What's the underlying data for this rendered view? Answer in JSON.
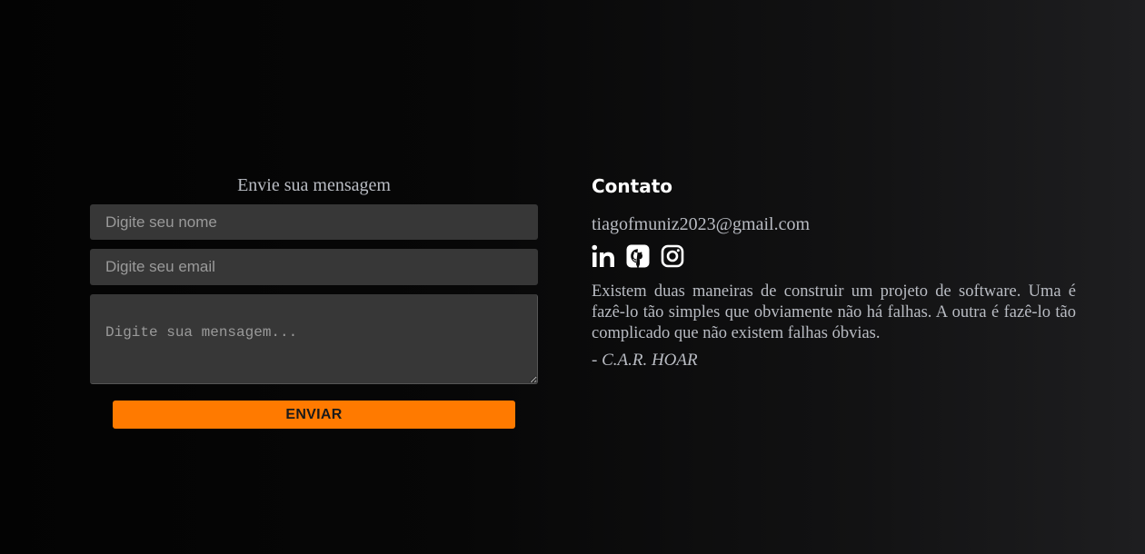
{
  "form": {
    "title": "Envie sua mensagem",
    "name_placeholder": "Digite seu nome",
    "email_placeholder": "Digite seu email",
    "message_placeholder": "Digite sua mensagem...",
    "submit_label": "ENVIAR"
  },
  "contact": {
    "title": "Contato",
    "email": "tiagofmuniz2023@gmail.com",
    "social": [
      {
        "icon": "linkedin-icon"
      },
      {
        "icon": "github-icon"
      },
      {
        "icon": "instagram-icon"
      }
    ],
    "quote": "Existem duas maneiras de construir um projeto de software. Uma é fazê-lo tão simples que obviamente não há falhas. A outra é fazê-lo tão complicado que não existem falhas óbvias.",
    "author": "- C.A.R. HOAR"
  },
  "colors": {
    "accent": "#ff7a00",
    "field_bg": "#373737",
    "text_muted": "#b9bcc3"
  }
}
